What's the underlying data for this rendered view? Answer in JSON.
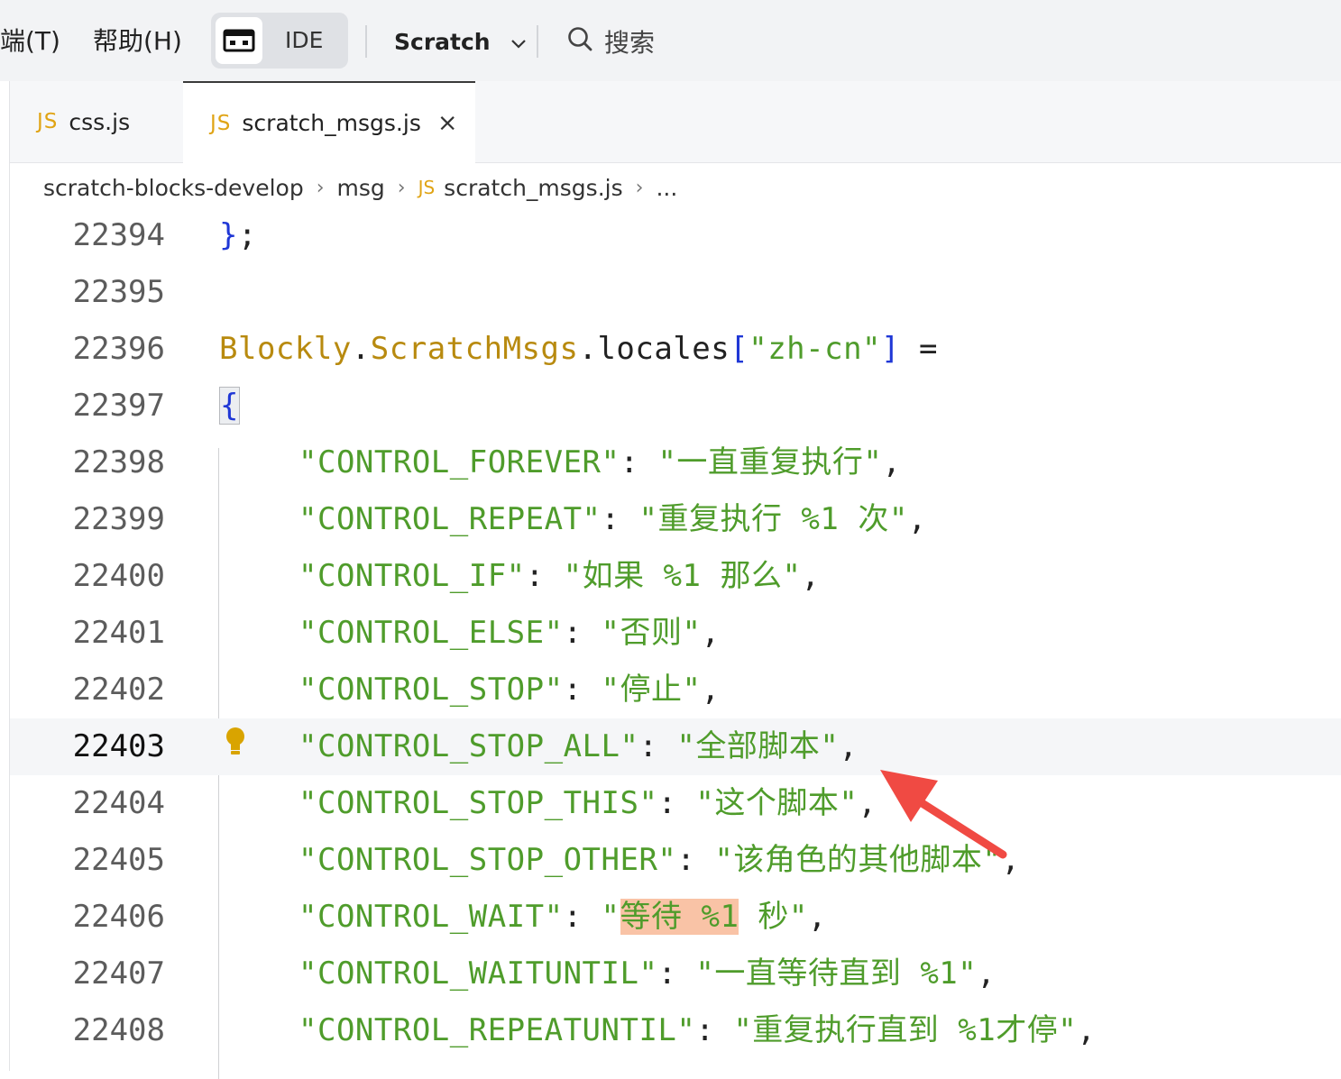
{
  "menu": {
    "terminal": "端(T)",
    "help": "帮助(H)"
  },
  "toolbar": {
    "ide_label": "IDE",
    "project_name": "Scratch",
    "search_label": "搜索"
  },
  "tabs": [
    {
      "lang": "JS",
      "label": "css.js"
    },
    {
      "lang": "JS",
      "label": "scratch_msgs.js",
      "close": "×"
    }
  ],
  "breadcrumb": {
    "root": "scratch-blocks-develop",
    "folder": "msg",
    "file_lang": "JS",
    "file": "scratch_msgs.js",
    "more": "..."
  },
  "colors": {
    "string": "#4f9c2b",
    "object": "#b88a0f",
    "bracket": "#1f37d6",
    "highlight": "#f9c3a6",
    "annotation_arrow": "#f04a43",
    "bulb": "#d9a400"
  },
  "icons": {
    "ide_toggle": "code-window-icon",
    "dropdown": "chevron-down-icon",
    "search": "search-icon",
    "intention": "lightbulb-icon",
    "annotation": "red-arrow-icon"
  },
  "code": {
    "caret_line": "22403",
    "lines": [
      {
        "num": "22394",
        "brace": "}",
        "semi": ";"
      },
      {
        "num": "22395"
      },
      {
        "num": "22396",
        "obj1": "Blockly",
        "dot1": ".",
        "obj2": "ScratchMsgs",
        "dot2": ".",
        "prop": "locales",
        "lb": "[",
        "key": "\"zh-cn\"",
        "rb": "]",
        "eq": " ="
      },
      {
        "num": "22397",
        "brace": "{"
      },
      {
        "num": "22398",
        "key": "\"CONTROL_FOREVER\"",
        "colon": ": ",
        "val": "\"一直重复执行\"",
        "comma": ","
      },
      {
        "num": "22399",
        "key": "\"CONTROL_REPEAT\"",
        "colon": ": ",
        "val": "\"重复执行 %1 次\"",
        "comma": ","
      },
      {
        "num": "22400",
        "key": "\"CONTROL_IF\"",
        "colon": ": ",
        "val": "\"如果 %1 那么\"",
        "comma": ","
      },
      {
        "num": "22401",
        "key": "\"CONTROL_ELSE\"",
        "colon": ": ",
        "val": "\"否则\"",
        "comma": ","
      },
      {
        "num": "22402",
        "key": "\"CONTROL_STOP\"",
        "colon": ": ",
        "val": "\"停止\"",
        "comma": ","
      },
      {
        "num": "22403",
        "key": "\"CONTROL_STOP_ALL\"",
        "colon": ": ",
        "val": "\"全部脚本\"",
        "comma": ","
      },
      {
        "num": "22404",
        "key": "\"CONTROL_STOP_THIS\"",
        "colon": ": ",
        "val": "\"这个脚本\"",
        "comma": ","
      },
      {
        "num": "22405",
        "key": "\"CONTROL_STOP_OTHER\"",
        "colon": ": ",
        "val": "\"该角色的其他脚本\"",
        "comma": ","
      },
      {
        "num": "22406",
        "key": "\"CONTROL_WAIT\"",
        "colon": ": ",
        "q1": "\"",
        "val_hl": "等待 %1",
        "val_rest": " 秒\"",
        "comma": ","
      },
      {
        "num": "22407",
        "key": "\"CONTROL_WAITUNTIL\"",
        "colon": ": ",
        "val": "\"一直等待直到 %1\"",
        "comma": ","
      },
      {
        "num": "22408",
        "key": "\"CONTROL_REPEATUNTIL\"",
        "colon": ": ",
        "val": "\"重复执行直到 %1才停\"",
        "comma": ","
      }
    ]
  }
}
